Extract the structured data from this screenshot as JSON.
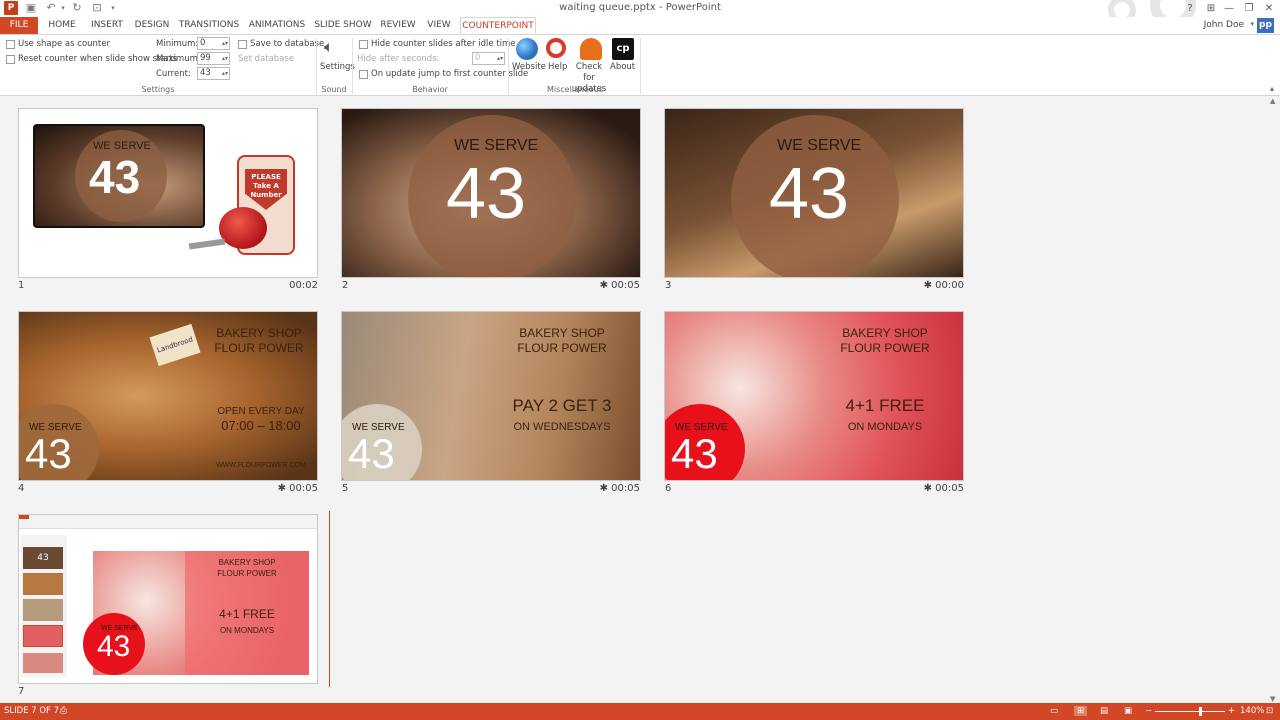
{
  "window": {
    "title": "waiting queue.pptx - PowerPoint",
    "help_icon": "?",
    "app_icon_letter": "P"
  },
  "tabs": [
    "FILE",
    "HOME",
    "INSERT",
    "DESIGN",
    "TRANSITIONS",
    "ANIMATIONS",
    "SLIDE SHOW",
    "REVIEW",
    "VIEW",
    "COUNTERPOINT"
  ],
  "active_tab": "COUNTERPOINT",
  "user": {
    "name": "John Doe",
    "avatar": "pp"
  },
  "ribbon": {
    "settings": {
      "use_shape": "Use shape as counter",
      "reset_counter": "Reset counter when slide show starts",
      "minimum_label": "Minimum:",
      "minimum_value": "0",
      "maximum_label": "Maximum:",
      "maximum_value": "99",
      "current_label": "Current:",
      "current_value": "43",
      "save_db": "Save to database",
      "set_db": "Set database",
      "group_label": "Settings"
    },
    "sound": {
      "button": "Settings",
      "group_label": "Sound"
    },
    "behavior": {
      "hide_idle": "Hide counter slides after idle time",
      "hide_after": "Hide after seconds:",
      "hide_after_value": "0",
      "jump_first": "On update jump to first counter slide",
      "group_label": "Behavior"
    },
    "misc": {
      "website": "Website",
      "help": "Help",
      "check_updates": "Check for updates",
      "about": "About",
      "about_logo": "cp",
      "group_label": "Miscellaneous"
    }
  },
  "slides": [
    {
      "index": "1",
      "time": "00:02",
      "we_serve": "WE SERVE",
      "number": "43",
      "ticket": "PLEASE Take A Number"
    },
    {
      "index": "2",
      "time": "00:05",
      "we_serve": "WE SERVE",
      "number": "43"
    },
    {
      "index": "3",
      "time": "00:00",
      "we_serve": "WE SERVE",
      "number": "43"
    },
    {
      "index": "4",
      "time": "00:05",
      "shop": "BAKERY SHOP",
      "brand": "FLOUR POWER",
      "line1": "OPEN EVERY DAY",
      "line2": "07:00 – 18:00",
      "url": "WWW.FLOURPOWER.COM",
      "label": "Landbrood",
      "we_serve": "WE SERVE",
      "number": "43"
    },
    {
      "index": "5",
      "time": "00:05",
      "shop": "BAKERY SHOP",
      "brand": "FLOUR POWER",
      "line1": "PAY 2 GET 3",
      "line2": "ON WEDNESDAYS",
      "we_serve": "WE SERVE",
      "number": "43"
    },
    {
      "index": "6",
      "time": "00:05",
      "shop": "BAKERY SHOP",
      "brand": "FLOUR POWER",
      "line1": "4+1 FREE",
      "line2": "ON MONDAYS",
      "we_serve": "WE SERVE",
      "number": "43"
    },
    {
      "index": "7",
      "shop": "BAKERY SHOP",
      "brand": "FLOUR POWER",
      "line1": "4+1 FREE",
      "line2": "ON MONDAYS",
      "we_serve": "WE SERVE",
      "number": "43",
      "mini_number": "43"
    }
  ],
  "transition_icon": "✱",
  "statusbar": {
    "slide": "SLIDE 7 OF 7",
    "zoom": "140%"
  },
  "colors": {
    "accent": "#d24726",
    "brown": "#8b5a3c",
    "red": "#e8101a"
  }
}
